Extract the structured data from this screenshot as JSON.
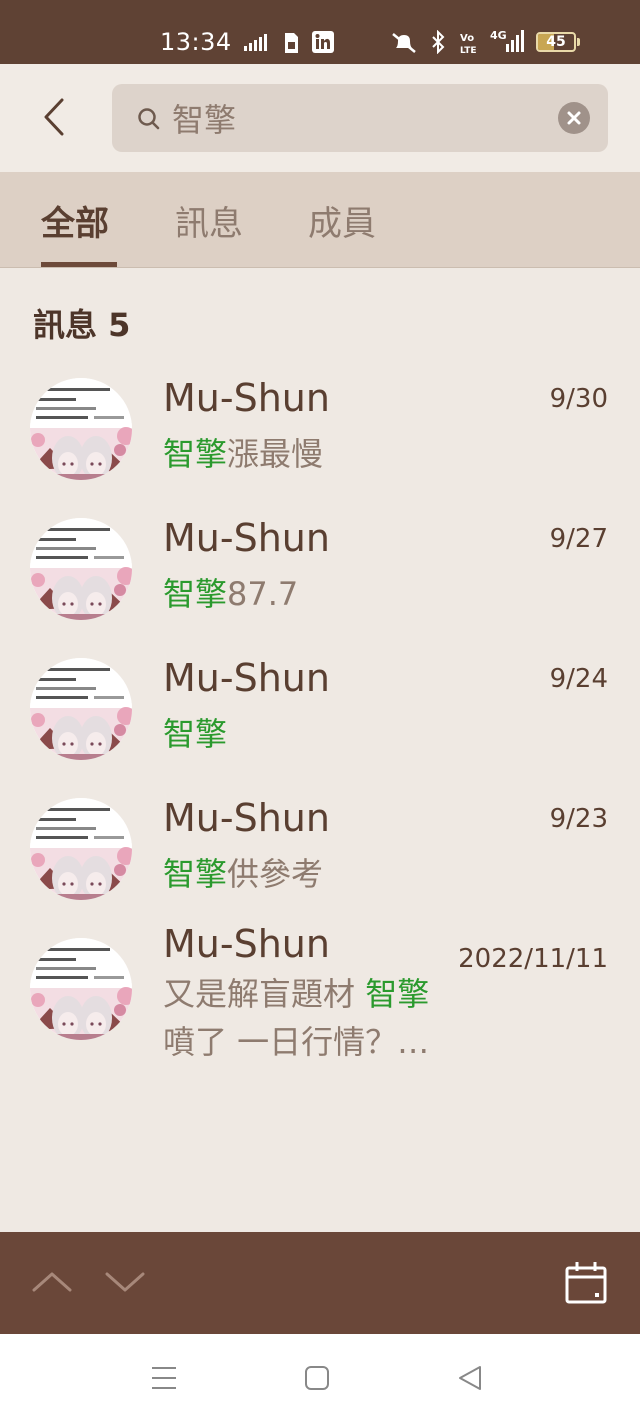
{
  "status_bar": {
    "time": "13:34",
    "icons": [
      "signal-speed-icon",
      "sim-icon",
      "linkedin-icon",
      "mute-icon",
      "bluetooth-icon",
      "volte-icon",
      "4g-signal-icon"
    ],
    "battery_level": "45",
    "battery_fraction": 0.45
  },
  "search": {
    "query": "智擎",
    "placeholder": ""
  },
  "tabs": [
    {
      "label": "全部",
      "active": true
    },
    {
      "label": "訊息",
      "active": false
    },
    {
      "label": "成員",
      "active": false
    }
  ],
  "section": {
    "title": "訊息 5"
  },
  "results": [
    {
      "sender": "Mu-Shun",
      "date": "9/30",
      "before": "",
      "highlight": "智擎",
      "after": "漲最慢",
      "line2": ""
    },
    {
      "sender": "Mu-Shun",
      "date": "9/27",
      "before": "",
      "highlight": "智擎",
      "after": "87.7",
      "line2": ""
    },
    {
      "sender": "Mu-Shun",
      "date": "9/24",
      "before": "",
      "highlight": "智擎",
      "after": "",
      "line2": ""
    },
    {
      "sender": "Mu-Shun",
      "date": "9/23",
      "before": "",
      "highlight": "智擎",
      "after": "供參考",
      "line2": ""
    },
    {
      "sender": "Mu-Shun",
      "date": "2022/11/11",
      "before": "又是解盲題材 ",
      "highlight": "智擎",
      "after": "",
      "line2": "噴了 一日行情？…"
    }
  ],
  "toolbar": {
    "icons": [
      "chevron-up-icon",
      "chevron-down-icon",
      "calendar-icon"
    ]
  },
  "colors": {
    "accent_brown": "#6a4739",
    "highlight_green": "#2b9a2e",
    "background": "#efe9e3"
  }
}
